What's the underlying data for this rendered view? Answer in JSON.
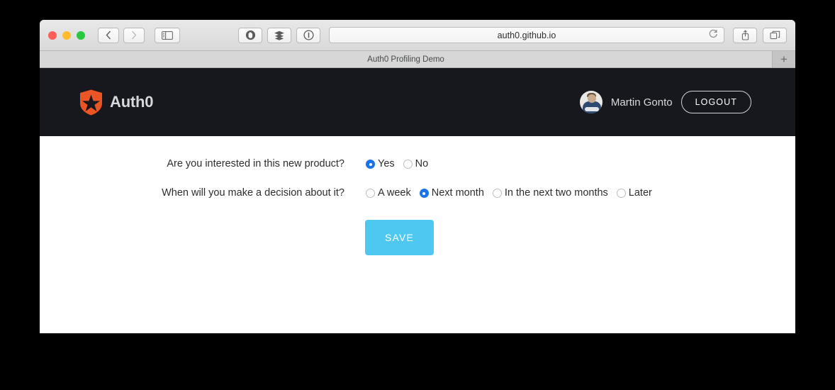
{
  "browser": {
    "url": "auth0.github.io",
    "tab_title": "Auth0 Profiling Demo",
    "new_tab_label": "+",
    "back_label": "‹",
    "forward_label": "›",
    "reload_label": "↻"
  },
  "header": {
    "brand_name": "Auth0",
    "user_name": "Martin Gonto",
    "logout_label": "LOGOUT",
    "background_color": "#16181d",
    "brand_color": "#eb5424"
  },
  "form": {
    "questions": [
      {
        "label": "Are you interested in this new product?",
        "options": [
          {
            "label": "Yes",
            "selected": true
          },
          {
            "label": "No",
            "selected": false
          }
        ]
      },
      {
        "label": "When will you make a decision about it?",
        "options": [
          {
            "label": "A week",
            "selected": false
          },
          {
            "label": "Next month",
            "selected": true
          },
          {
            "label": "In the next two months",
            "selected": false
          },
          {
            "label": "Later",
            "selected": false
          }
        ]
      }
    ],
    "save_label": "SAVE",
    "save_color": "#4fc8f1",
    "radio_selected_color": "#1a73e8"
  }
}
